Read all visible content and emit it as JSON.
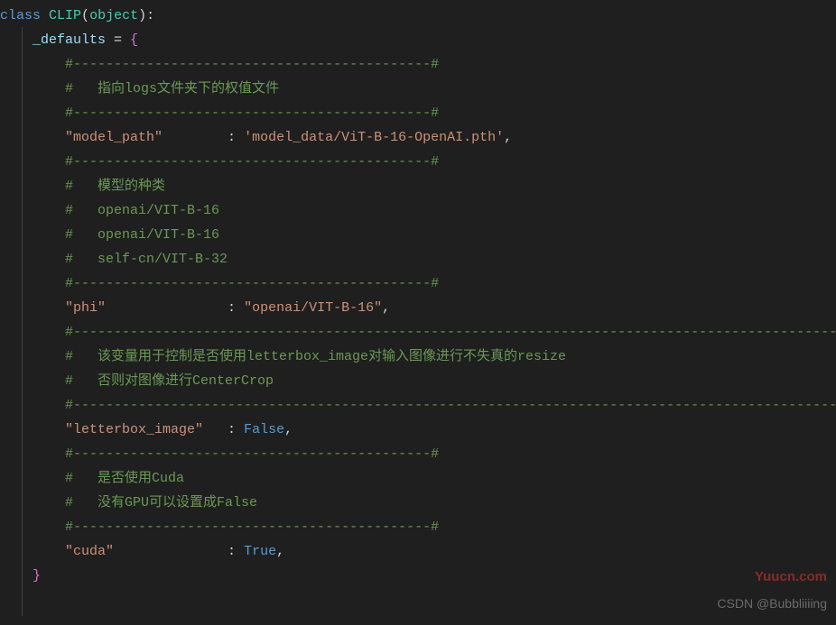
{
  "code": {
    "kw_class": "class",
    "cls_name": "CLIP",
    "obj_name": "object",
    "defaults_var": "_defaults",
    "eq": " = ",
    "brace_open": "{",
    "brace_close": "}",
    "c1": "#--------------------------------------------#",
    "c2": "#   指向logs文件夹下的权值文件",
    "c3": "#--------------------------------------------#",
    "k_model_path": "\"model_path\"",
    "colon_model": "        : ",
    "v_model_path": "'model_data/ViT-B-16-OpenAI.pth'",
    "comma": ",",
    "c4": "#--------------------------------------------#",
    "c5": "#   模型的种类",
    "c6": "#   openai/VIT-B-16",
    "c7": "#   openai/VIT-B-16",
    "c8": "#   self-cn/VIT-B-32",
    "c9": "#--------------------------------------------#",
    "k_phi": "\"phi\"",
    "colon_phi": "               : ",
    "v_phi": "\"openai/VIT-B-16\"",
    "c10": "#-------------------------------------------------------------------------------------------------#",
    "c11": "#   该变量用于控制是否使用letterbox_image对输入图像进行不失真的resize",
    "c12": "#   否则对图像进行CenterCrop",
    "c13": "#-------------------------------------------------------------------------------------------------#",
    "k_lb": "\"letterbox_image\"",
    "colon_lb": "   : ",
    "v_false": "False",
    "c14": "#--------------------------------------------#",
    "c15": "#   是否使用Cuda",
    "c16": "#   没有GPU可以设置成False",
    "c17": "#--------------------------------------------#",
    "k_cuda": "\"cuda\"",
    "colon_cuda": "              : ",
    "v_true": "True"
  },
  "watermark_right": "Yuucn.com",
  "watermark_bottom": "CSDN @Bubbliiiing"
}
